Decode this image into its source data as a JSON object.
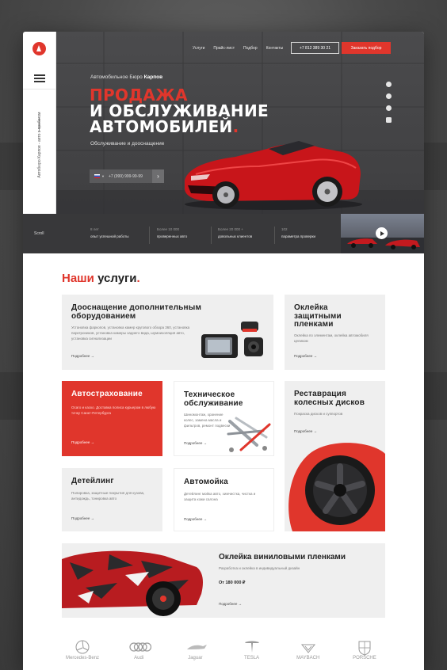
{
  "nav": {
    "items": [
      "Услуги",
      "Прайс-лист",
      "Подбор",
      "Контакты"
    ],
    "phone": "+7 812 389 30 21",
    "cta": "Заказать подбор"
  },
  "rail": {
    "text": "Автобюро Карпов - авто с пробегом"
  },
  "hero": {
    "subtitle_prefix": "Автомобильное Бюро",
    "subtitle_brand": "Карпов",
    "title_line1": "ПРОДАЖА",
    "title_line2": "И ОБСЛУЖИВАНИЕ",
    "title_line3": "АВТОМОБИЛЕЙ",
    "title_dot": ".",
    "description": "Обслуживание и дооснащение",
    "phone_placeholder": "+7 (999) 999-99-99"
  },
  "stats": {
    "scroll": "Scroll",
    "items": [
      {
        "number": "8 лет",
        "label": "опыт успешной работы"
      },
      {
        "number": "Более 10 000",
        "label": "проверенных авто"
      },
      {
        "number": "Более 20 000 +",
        "label": "довольных клиентов"
      },
      {
        "number": "102",
        "label": "параметра проверки"
      }
    ]
  },
  "services": {
    "title": "Наши",
    "title_rest": " услуги",
    "title_dot": ".",
    "more": "Подробнее →",
    "cards": [
      {
        "title": "Дооснащение дополнительным оборудованием",
        "text": "Установка фаркопов, установка камер кругового обзора 360, установка парктроников, установка камеры заднего вида, шумоизоляция авто, установка сигнализации"
      },
      {
        "title": "Оклейка защитными пленками",
        "text": "Оклейка по элементам, оклейка автомобиля целиком"
      },
      {
        "title": "Автострахование",
        "text": "Осаго и каско. Доставка полиса курьером в любую точку Санкт-Петербурга"
      },
      {
        "title": "Техническое обслуживание",
        "text": "Шиномонтаж, хранение колес, замена масла и фильтров, ремонт подвески"
      },
      {
        "title": "Реставрация колесных дисков",
        "text": "Покраска дисков и суппортов"
      },
      {
        "title": "Детейлинг",
        "text": "Полировка, защитные покрытия для кузова, антидождь, тонировка авто"
      },
      {
        "title": "Автомойка",
        "text": "Детейлинг мойка авто, химчистка, чистка и защита кожи салона"
      }
    ],
    "vinyl": {
      "title": "Оклейка виниловыми пленками",
      "text": "Разработка и оклейка в индивидуальный дизайн",
      "price": "От 180 000 ₽"
    }
  },
  "brands": [
    "Mercedes-Benz",
    "Audi",
    "Jaguar",
    "TESLA",
    "MAYBACH",
    "PORSCHE"
  ],
  "colors": {
    "accent": "#e0362c",
    "dark": "#3c3c3e",
    "card": "#efefef"
  }
}
